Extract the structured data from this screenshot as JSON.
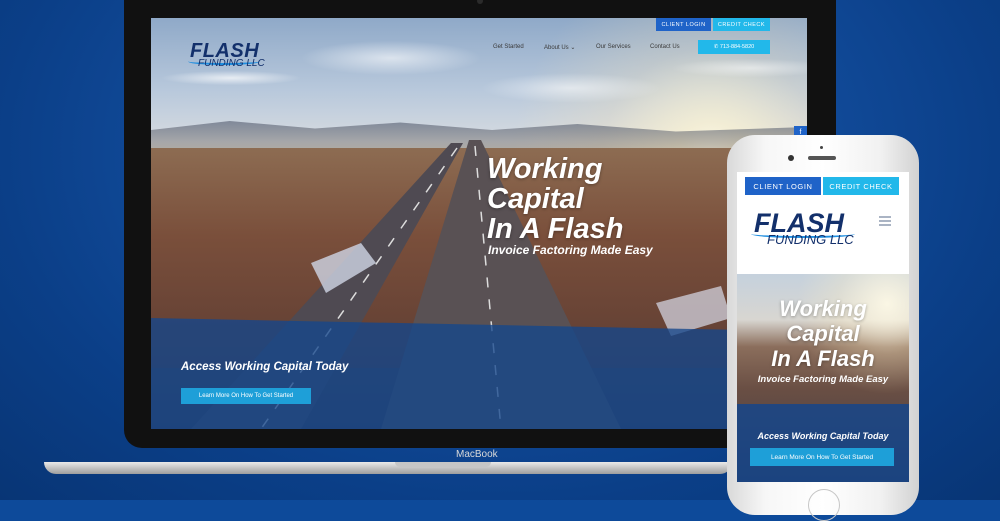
{
  "laptop": {
    "brand_label": "MacBook",
    "site": {
      "logo": {
        "line1": "FLASH",
        "line2": "FUNDING LLC"
      },
      "utility": {
        "client_login": "CLIENT LOGIN",
        "credit_check": "CREDIT CHECK"
      },
      "nav": [
        {
          "label": "Get Started"
        },
        {
          "label": "About Us ⌄"
        },
        {
          "label": "Our Services"
        },
        {
          "label": "Contact Us"
        }
      ],
      "phone_button": "✆ 713-884-5820",
      "facebook_icon": "f",
      "hero": {
        "title": "Working\nCapital\nIn A Flash",
        "subtitle": "Invoice Factoring Made Easy",
        "access": "Access Working Capital Today",
        "cta": "Learn More On How To Get Started"
      }
    }
  },
  "phone": {
    "site": {
      "logo": {
        "line1": "FLASH",
        "line2": "FUNDING LLC"
      },
      "utility": {
        "client_login": "CLIENT LOGIN",
        "credit_check": "CREDIT CHECK"
      },
      "menu_icon": "hamburger-icon",
      "hero": {
        "title": "Working\nCapital\nIn A Flash",
        "subtitle": "Invoice Factoring Made Easy",
        "access": "Access Working Capital Today",
        "cta": "Learn More On How To Get Started"
      }
    }
  },
  "colors": {
    "background": "#0d4a9a",
    "brand_navy": "#13306b",
    "accent_blue": "#1f63c8",
    "accent_cyan": "#22b8ea"
  }
}
